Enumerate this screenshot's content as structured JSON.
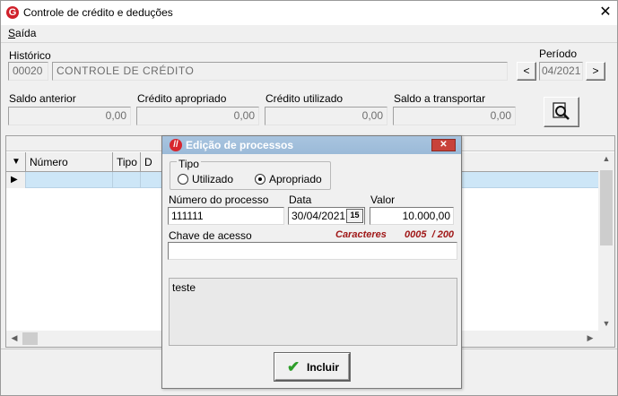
{
  "window": {
    "title": "Controle de crédito e deduções",
    "close_glyph": "✕",
    "app_icon_letter": "G"
  },
  "menu": {
    "saida": "Saída"
  },
  "historico": {
    "label": "Histórico",
    "code": "00020",
    "description": "CONTROLE DE CRÉDITO"
  },
  "periodo": {
    "label": "Período",
    "value": "04/2021",
    "prev": "<",
    "next": ">"
  },
  "saldos": {
    "saldo_anterior": {
      "label": "Saldo anterior",
      "value": "0,00"
    },
    "credito_apropriado": {
      "label": "Crédito apropriado",
      "value": "0,00"
    },
    "credito_utilizado": {
      "label": "Crédito utilizado",
      "value": "0,00"
    },
    "saldo_a_transportar": {
      "label": "Saldo a transportar",
      "value": "0,00"
    }
  },
  "grid": {
    "columns": [
      "Número",
      "Tipo",
      "D"
    ],
    "row_indicator": "▶",
    "header_indicator": "▼"
  },
  "dialog": {
    "title": "Edição de processos",
    "close_glyph": "✕",
    "tipo": {
      "label": "Tipo",
      "options": [
        "Utilizado",
        "Apropriado"
      ],
      "selected": "Apropriado"
    },
    "numero": {
      "label": "Número do processo",
      "value": "111111"
    },
    "data": {
      "label": "Data",
      "value": "30/04/2021",
      "calendar_glyph": "15"
    },
    "valor": {
      "label": "Valor",
      "value": "10.000,00"
    },
    "chave": {
      "label": "Chave de acesso",
      "caracteres_label": "Caracteres",
      "caracteres_count": "0005  / 200",
      "value": ""
    },
    "memo": {
      "value": "teste"
    },
    "incluir_label": "Incluir"
  },
  "colors": {
    "accent": "#d0202a",
    "dialog_title": "#9bbad8",
    "selected_row": "#cde6f7",
    "counter_text": "#a01818"
  }
}
